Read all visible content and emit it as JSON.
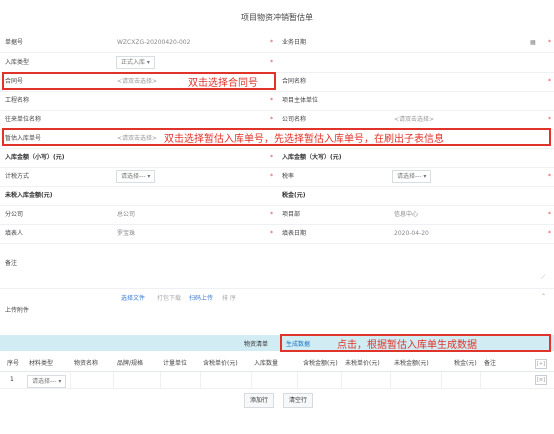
{
  "title": "项目物资冲销暂估单",
  "form": {
    "doc_no_label": "单据号",
    "doc_no_value": "WZCXZG-20200420-002",
    "biz_date_label": "业务日期",
    "in_type_label": "入库类型",
    "in_type_value": "正式入库",
    "contract_no_label": "合同号",
    "contract_no_placeholder": "<请双击选择>",
    "contract_name_label": "合同名称",
    "project_name_label": "工程名称",
    "project_unit_label": "项目主体单位",
    "partner_label": "往来单位名称",
    "company_name_label": "公司名称",
    "company_name_placeholder": "<请双击选择>",
    "est_in_no_label": "暂估入库单号",
    "est_in_no_placeholder": "<请双击选择>",
    "amount_small_label": "入库金额（小写）(元)",
    "amount_big_label": "入库金额（大写）(元)",
    "tax_method_label": "计税方式",
    "tax_method_value": "请选择---",
    "tax_rate_label": "税率",
    "tax_rate_value": "请选择---",
    "untaxed_amount_label": "未税入库金额(元)",
    "tax_amount_label": "税金(元)",
    "branch_label": "分公司",
    "branch_value": "总公司",
    "project_dept_label": "项目部",
    "project_dept_value": "信息中心",
    "filler_label": "填表人",
    "filler_value": "罗宝珠",
    "fill_date_label": "填表日期",
    "fill_date_value": "2020-04-20",
    "remark_label": "备注",
    "attach_label": "上传附件",
    "attach_actions": [
      "选择文件",
      "打包下载",
      "扫码上传",
      "排 序"
    ]
  },
  "annotations": {
    "contract": "双击选择合同号",
    "est_in": "双击选择暂估入库单号，先选择暂估入库单号，在刷出子表信息",
    "generate": "点击，根据暂估入库单生成数据"
  },
  "detail": {
    "section_label": "物资清单",
    "generate_button": "生成数据",
    "headers": [
      "序号",
      "材料类型",
      "物资名称",
      "品牌/规格",
      "计量单位",
      "含税单价(元)",
      "入库数量",
      "含税金额(元)",
      "未税单价(元)",
      "未税金额(元)",
      "税金(元)",
      "备注"
    ],
    "plus_icon": "[+]",
    "row_index": "1",
    "row_type_value": "请选择---",
    "row_menu_icon": "[≡]",
    "add_row_button": "添加行",
    "clear_row_button": "清空行"
  },
  "colors": {
    "annotation": "#e0342b",
    "teal_bar": "#d1ecf3",
    "required": "#e54545"
  }
}
